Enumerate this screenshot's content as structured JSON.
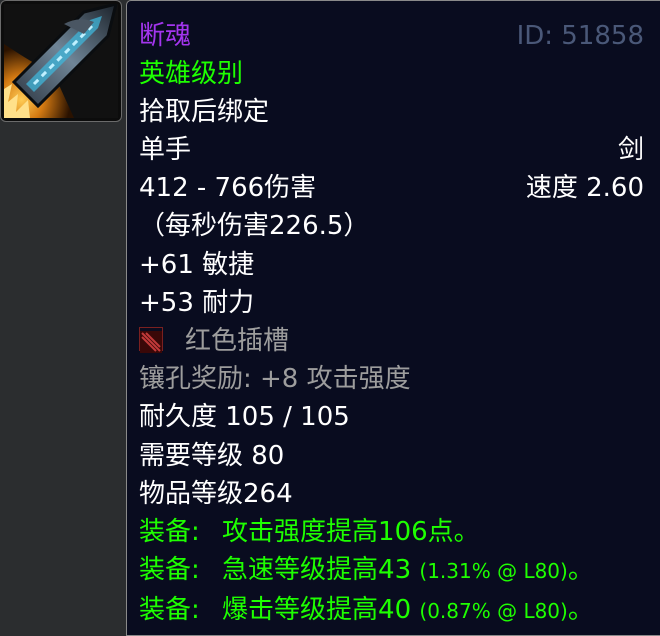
{
  "icon": {
    "name": "sword-icon"
  },
  "item": {
    "name": "断魂",
    "id_label": "ID: 51858",
    "quality": "英雄级别",
    "binding": "拾取后绑定",
    "slot": "单手",
    "weapon_type": "剑",
    "damage": "412 - 766伤害",
    "speed": "速度 2.60",
    "dps": "（每秒伤害226.5）",
    "stat1": "+61 敏捷",
    "stat2": "+53 耐力",
    "socket": {
      "icon": "red-socket-icon",
      "label": "红色插槽"
    },
    "socket_bonus": "镶孔奖励: +8 攻击强度",
    "durability": "耐久度 105 / 105",
    "req_level": "需要等级 80",
    "item_level": "物品等级264",
    "equip": [
      {
        "prefix": "装备:",
        "text": "攻击强度提高106点。",
        "detail": ""
      },
      {
        "prefix": "装备:",
        "text": "急速等级提高43",
        "detail": "(1.31% @ L80)",
        "end": "。"
      },
      {
        "prefix": "装备:",
        "text": "爆击等级提高40",
        "detail": "(0.87% @ L80)",
        "end": "。"
      }
    ]
  },
  "colors": {
    "epic": "#a335ee",
    "green": "#1eff00",
    "grey": "#9d9d9d",
    "white": "#ffffff",
    "background": "#090c1f"
  }
}
